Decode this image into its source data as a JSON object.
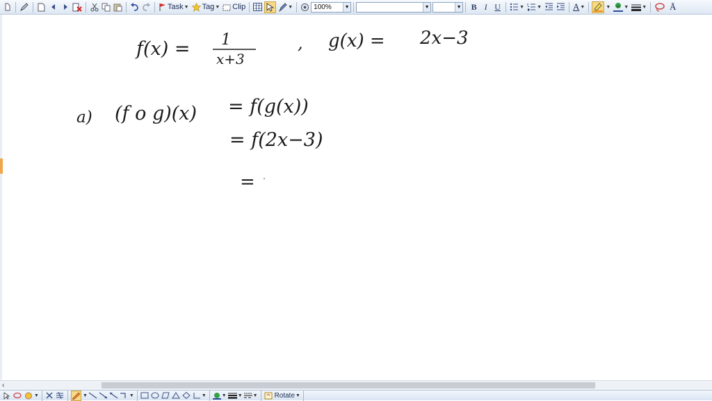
{
  "toolbar": {
    "task_label": "Task",
    "tag_label": "Tag",
    "clip_label": "Clip",
    "zoom_value": "100%",
    "bold_label": "B",
    "italic_label": "I",
    "underline_label": "U",
    "font_color_glyph": "A",
    "far_right_glyph": "Ā"
  },
  "canvas": {
    "line1_f": "f(x) =",
    "line1_num": "1",
    "line1_den": "x+3",
    "line1_sep": ",",
    "line1_g": "g(x) =",
    "line1_g_rhs": "2x−3",
    "part_a_label": "a)",
    "step1_lhs": "(f o g)(x)",
    "step1_rhs": "=  f(g(x))",
    "step2_rhs": "=  f(2x−3)",
    "step3_rhs": "="
  },
  "bottombar": {
    "rotate_label": "Rotate"
  },
  "colors": {
    "toolbar_bg": "#dde7f3",
    "ink": "#1a1a1a",
    "highlight_orange": "#f0a64a",
    "active_tool": "#f7d987"
  }
}
